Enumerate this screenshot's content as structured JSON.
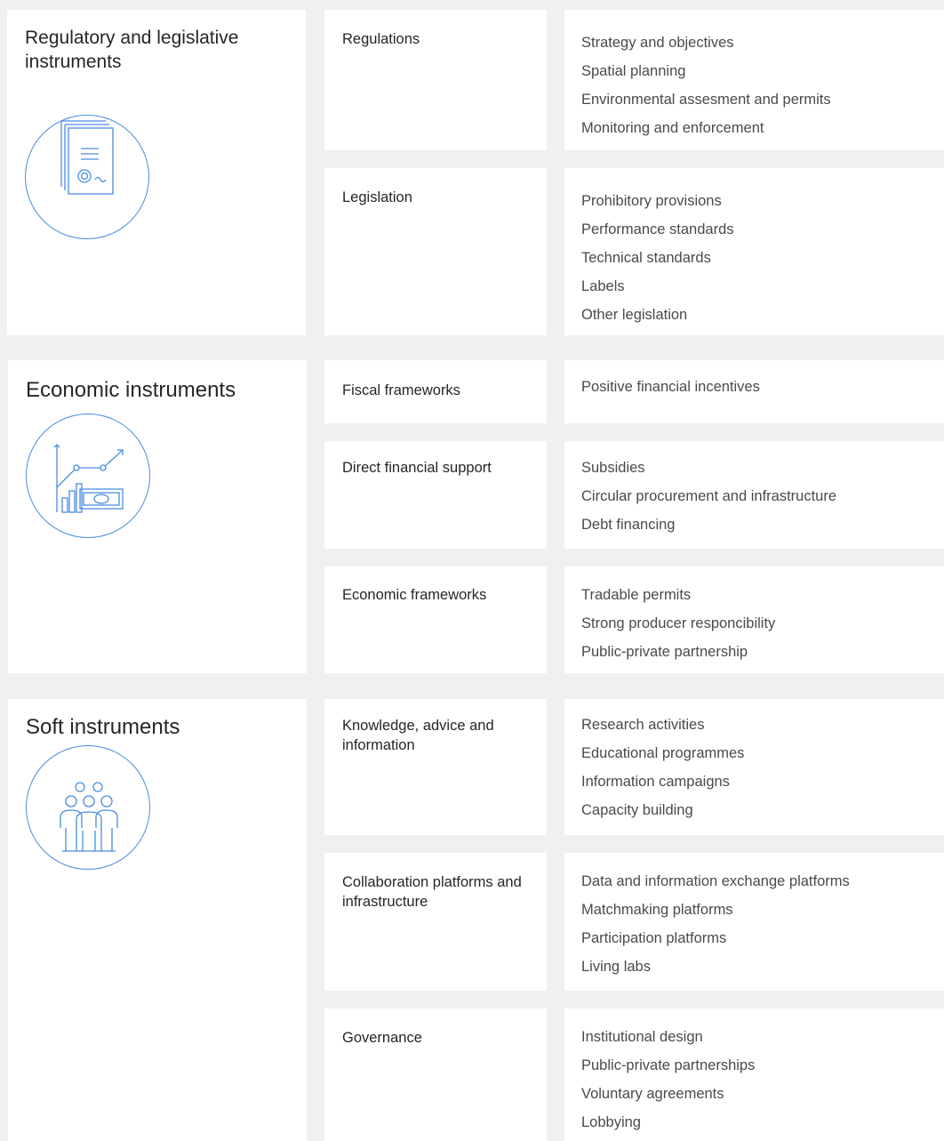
{
  "accent_color": "#4a8ce0",
  "groups": [
    {
      "title": "Regulatory and legislative instruments",
      "icon": "legal-document-icon",
      "categories": [
        {
          "label": "Regulations",
          "items": [
            "Strategy and objectives",
            "Spatial planning",
            "Environmental assesment and permits",
            "Monitoring and enforcement"
          ]
        },
        {
          "label": "Legislation",
          "items": [
            "Prohibitory provisions",
            "Performance standards",
            "Technical standards",
            "Labels",
            "Other legislation"
          ]
        }
      ]
    },
    {
      "title": "Economic instruments",
      "icon": "financial-growth-icon",
      "categories": [
        {
          "label": "Fiscal frameworks",
          "items": [
            "Positive financial incentives"
          ]
        },
        {
          "label": "Direct financial support",
          "items": [
            "Subsidies",
            "Circular procurement and infrastructure",
            "Debt financing"
          ]
        },
        {
          "label": "Economic frameworks",
          "items": [
            "Tradable permits",
            "Strong producer responcibility",
            "Public-private partnership"
          ]
        }
      ]
    },
    {
      "title": "Soft instruments",
      "icon": "people-group-icon",
      "categories": [
        {
          "label": "Knowledge, advice and information",
          "items": [
            "Research activities",
            "Educational programmes",
            "Information campaigns",
            "Capacity building"
          ]
        },
        {
          "label": "Collaboration platforms and infrastructure",
          "items": [
            "Data and information exchange platforms",
            "Matchmaking platforms",
            "Participation platforms",
            "Living labs"
          ]
        },
        {
          "label": "Governance",
          "items": [
            "Institutional design",
            "Public-private partnerships",
            "Voluntary agreements",
            "Lobbying"
          ]
        }
      ]
    }
  ]
}
